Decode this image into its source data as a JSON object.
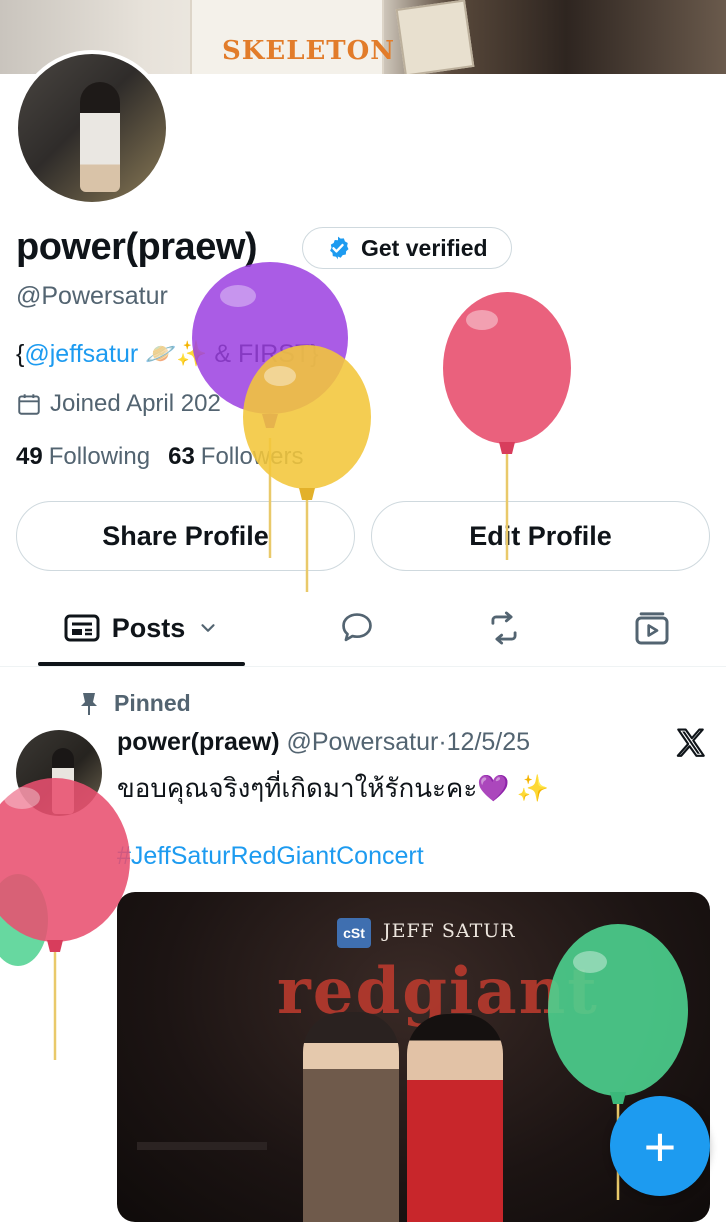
{
  "profile": {
    "display_name": "power(praew)",
    "verify_button": "Get verified",
    "handle": "@Powersatur",
    "bio_prefix": "{",
    "bio_mention": "@jeffsatur",
    "bio_emojis": "🪐✨",
    "bio_rest": " & FIRST}",
    "joined": "Joined April 202",
    "following_count": "49",
    "following_label": "Following",
    "followers_count": "63",
    "followers_label": "Followers"
  },
  "actions": {
    "share_label": "Share Profile",
    "edit_label": "Edit Profile"
  },
  "tabs": {
    "posts_label": "Posts",
    "icons": [
      "feed-icon",
      "reply-bubble-icon",
      "repost-icon",
      "media-icon"
    ]
  },
  "post": {
    "pinned_label": "Pinned",
    "name": "power(praew)",
    "handle": "@Powersatur",
    "separator": "·",
    "date": "12/5/25",
    "text": "ขอบคุณจริงๆที่เกิดมาให้รักนะคะ💜 ✨",
    "hashtag": "#JeffSaturRedGiantConcert",
    "media": {
      "logo": "cSt",
      "brand": "JEFF SATUR",
      "title": "redgiant"
    }
  },
  "fab_label": "+",
  "colors": {
    "accent": "#1d9bf0",
    "text": "#0f1419",
    "muted": "#536471",
    "border": "#cfd9de",
    "balloon_purple": "#9b3fe0",
    "balloon_yellow": "#f2c63a",
    "balloon_pink": "#e8506f",
    "balloon_green": "#4cd18f"
  }
}
